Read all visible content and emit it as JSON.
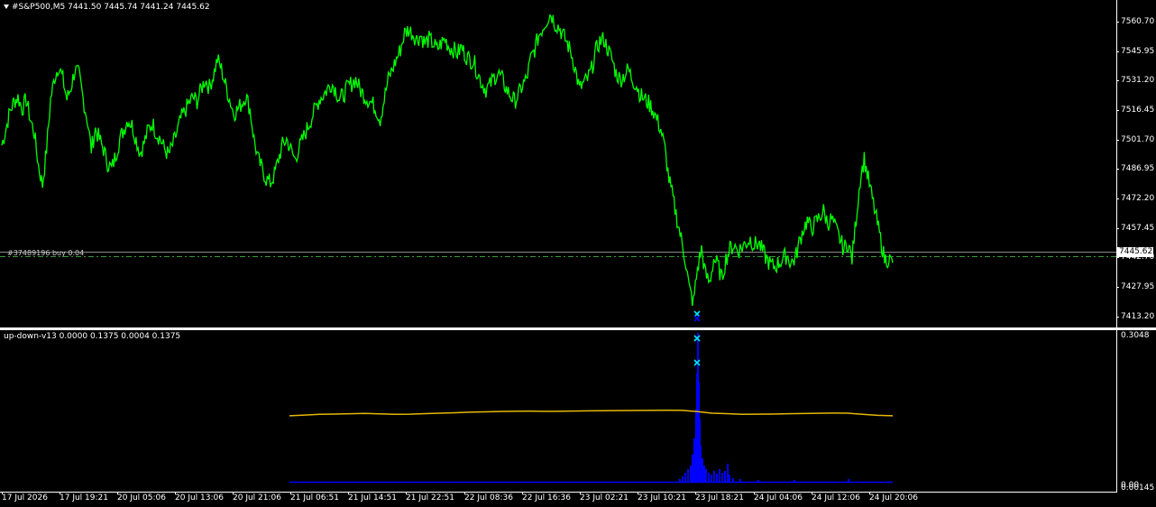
{
  "header": {
    "symbol": "#S&P500,M5",
    "ohlc": "7441.50 7445.74 7441.24 7445.62"
  },
  "order_line_label": "#37489196 buy 0.04",
  "indicator": {
    "label": "up-down-v13 0.0000 0.1375 0.0004 0.1375",
    "y_top": "0.3048",
    "y_zero": "0.00",
    "y_bottom": "0.00145"
  },
  "price_axis": {
    "ticks": [
      "7560.70",
      "7545.95",
      "7531.20",
      "7516.45",
      "7501.70",
      "7486.95",
      "7472.20",
      "7457.45",
      "7442.70",
      "7427.95",
      "7413.20"
    ],
    "current_price": "7445.62"
  },
  "time_axis": {
    "ticks": [
      "17 Jul 2026",
      "17 Jul 19:21",
      "20 Jul 05:06",
      "20 Jul 13:06",
      "20 Jul 21:06",
      "21 Jul 06:51",
      "21 Jul 14:51",
      "21 Jul 22:51",
      "22 Jul 08:36",
      "22 Jul 16:36",
      "23 Jul 02:21",
      "23 Jul 10:21",
      "23 Jul 18:21",
      "24 Jul 04:06",
      "24 Jul 12:06",
      "24 Jul 20:06"
    ]
  },
  "colors": {
    "background": "#000000",
    "price_line": "#00ff00",
    "indicator_line": "#e6b800",
    "histogram": "#0000ff",
    "marker": "#00e5ff",
    "order_line": "#3a9a3a"
  },
  "chart_data": {
    "type": "line",
    "series": [
      {
        "values": [
          7497,
          7505,
          7514,
          7519,
          7521,
          7515,
          7520,
          7510,
          7503,
          7487,
          7477,
          7495,
          7520,
          7531,
          7537,
          7530,
          7520,
          7526,
          7535,
          7532,
          7520,
          7510,
          7495,
          7505,
          7500,
          7495,
          7488,
          7485,
          7492,
          7500,
          7505,
          7510,
          7507,
          7500,
          7493,
          7498,
          7505,
          7508,
          7503,
          7500,
          7495,
          7492,
          7497,
          7503,
          7510,
          7514,
          7518,
          7521,
          7519,
          7525,
          7530,
          7526,
          7532,
          7540,
          7535,
          7527,
          7520,
          7513,
          7515,
          7518,
          7522,
          7515,
          7500,
          7490,
          7485,
          7480,
          7478,
          7482,
          7490,
          7497,
          7500,
          7495,
          7490,
          7495,
          7500,
          7505,
          7510,
          7515,
          7520,
          7522,
          7525,
          7528,
          7525,
          7520,
          7522,
          7526,
          7528,
          7530,
          7525,
          7522,
          7520,
          7518,
          7515,
          7510,
          7520,
          7530,
          7535,
          7540,
          7545,
          7553,
          7555,
          7553,
          7550,
          7552,
          7548,
          7550,
          7548,
          7545,
          7548,
          7550,
          7546,
          7545,
          7543,
          7546,
          7542,
          7540,
          7539,
          7533,
          7528,
          7525,
          7527,
          7531,
          7533,
          7530,
          7525,
          7522,
          7519,
          7522,
          7527,
          7530,
          7540,
          7545,
          7552,
          7556,
          7560,
          7563,
          7558,
          7556,
          7552,
          7548,
          7543,
          7535,
          7525,
          7528,
          7530,
          7535,
          7544,
          7549,
          7550,
          7545,
          7540,
          7533,
          7530,
          7532,
          7535,
          7530,
          7527,
          7522,
          7520,
          7518,
          7515,
          7510,
          7505,
          7495,
          7480,
          7470,
          7460,
          7450,
          7440,
          7425,
          7418,
          7435,
          7445,
          7432,
          7428,
          7440,
          7437,
          7430,
          7440,
          7445,
          7447,
          7444,
          7446,
          7448,
          7450,
          7447,
          7448,
          7444,
          7440,
          7437,
          7436,
          7438,
          7440,
          7442,
          7438,
          7440,
          7448,
          7455,
          7459,
          7455,
          7458,
          7461,
          7464,
          7458,
          7460,
          7455,
          7450,
          7445,
          7448,
          7440,
          7460,
          7480,
          7490,
          7480,
          7470,
          7460,
          7450,
          7440,
          7440,
          7438
        ]
      }
    ],
    "indicator_series": [
      {
        "values": [
          0.1375,
          0.139,
          0.1405,
          0.1412,
          0.1418,
          0.1425,
          0.1415,
          0.1405,
          0.141,
          0.142,
          0.143,
          0.144,
          0.145,
          0.1458,
          0.1465,
          0.147,
          0.1472,
          0.1468,
          0.147,
          0.1475,
          0.1478,
          0.148,
          0.1484,
          0.1486,
          0.1488,
          0.149,
          0.1488,
          0.1465,
          0.143,
          0.142,
          0.1405,
          0.141,
          0.1412,
          0.1418,
          0.1422,
          0.1428,
          0.1432,
          0.143,
          0.1405,
          0.1385,
          0.1375
        ]
      }
    ],
    "ylim": [
      7407,
      7567
    ],
    "indicator_ylim": [
      0.0,
      0.3048
    ]
  }
}
